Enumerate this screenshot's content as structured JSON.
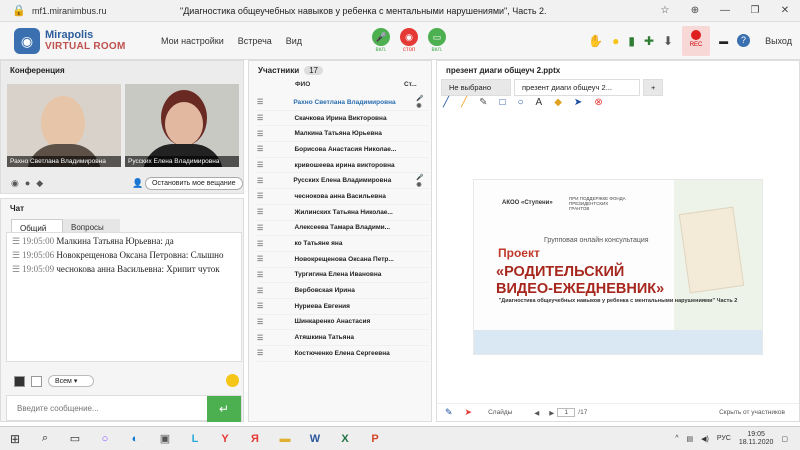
{
  "browser": {
    "url": "mf1.miranimbus.ru",
    "doc_title": "\"Диагностика общеучебных навыков у ребенка с ментальными нарушениями\", Часть 2."
  },
  "app": {
    "logo_line1": "Mirapolis",
    "logo_line2": "VIRTUAL ROOM",
    "menu": [
      "Мои настройки",
      "Встреча",
      "Вид"
    ],
    "controls": [
      {
        "label": "вкл.",
        "color": "#4caf50"
      },
      {
        "label": "стоп",
        "color": "#e53935"
      },
      {
        "label": "вкл.",
        "color": "#4caf50"
      }
    ],
    "rec_label": "REC",
    "exit": "Выход"
  },
  "conference": {
    "title": "Конференция",
    "stop_btn": "Остановить мое вещание",
    "videos": [
      {
        "name": "Рахно Светлана Владимировна"
      },
      {
        "name": "Русских Елена Владимировна"
      }
    ]
  },
  "chat": {
    "title": "Чат",
    "tabs": [
      "Общий",
      "Вопросы"
    ],
    "messages": [
      {
        "time": "19:05:00",
        "author": "Малкина Татьяна Юрьевна:",
        "text": "да"
      },
      {
        "time": "19:05:06",
        "author": "Новокрещенова Оксана Петровна:",
        "text": "Слышно"
      },
      {
        "time": "19:05:09",
        "author": "чеснокова анна Васильевна:",
        "text": "Хрипит чуток"
      }
    ],
    "audience": "Всем",
    "placeholder": "Введите сообщение..."
  },
  "participants": {
    "title": "Участники",
    "count": "17",
    "col_name": "ФИО",
    "col_status": "Ст...",
    "rows": [
      {
        "name": "Рахно Светлана Владимировна",
        "hl": true,
        "st": "🎤 ◉"
      },
      {
        "name": "Скачкова Ирина Викторовна",
        "hl": false,
        "st": ""
      },
      {
        "name": "Малкина Татьяна Юрьевна",
        "hl": false,
        "st": ""
      },
      {
        "name": "Борисова Анастасия Николае...",
        "hl": false,
        "st": ""
      },
      {
        "name": "кривошеева ирина викторовна",
        "hl": false,
        "st": ""
      },
      {
        "name": "Русских Елена Владимировна",
        "hl": false,
        "st": "🎤 ◉"
      },
      {
        "name": "чеснокова анна Васильевна",
        "hl": false,
        "st": ""
      },
      {
        "name": "Жилинских Татьяна Николае...",
        "hl": false,
        "st": ""
      },
      {
        "name": "Алексеева Тамара Владими...",
        "hl": false,
        "st": ""
      },
      {
        "name": "ко Татьяне яна",
        "hl": false,
        "st": ""
      },
      {
        "name": "Новокрещенова Оксана Петр...",
        "hl": false,
        "st": ""
      },
      {
        "name": "Тургигина Елена Ивановна",
        "hl": false,
        "st": ""
      },
      {
        "name": "Вербовская Ирина",
        "hl": false,
        "st": ""
      },
      {
        "name": "Нуриева Евгения",
        "hl": false,
        "st": ""
      },
      {
        "name": "Шинкаренко Анастасия",
        "hl": false,
        "st": ""
      },
      {
        "name": "Атяшкина Татьяна",
        "hl": false,
        "st": ""
      },
      {
        "name": "Костюченко Елена Сергеевна",
        "hl": false,
        "st": ""
      }
    ]
  },
  "presentation": {
    "title": "презент диаги общеуч 2.pptx",
    "tabs": [
      "Не выбрано",
      "презент диаги общеуч 2..."
    ],
    "slide": {
      "org": "АКОО «Ступени»",
      "fund": "ПРИ ПОДДЕРЖКЕ ФОНДА ПРЕЗИДЕНТСКИХ ГРАНТОВ",
      "subtitle": "Групповая онлайн консультация",
      "project": "Проект",
      "title1": "«РОДИТЕЛЬСКИЙ",
      "title2": "ВИДЕО-ЕЖЕДНЕВНИК»",
      "desc": "\"Диагностика общеучебных навыков у ребенка с ментальными нарушениями\" Часть 2"
    },
    "slides_label": "Слайды",
    "page": "1",
    "total": "/17",
    "hide": "Скрыть от участников"
  },
  "taskbar": {
    "lang": "РУС",
    "time": "19:05",
    "date": "18.11.2020"
  }
}
